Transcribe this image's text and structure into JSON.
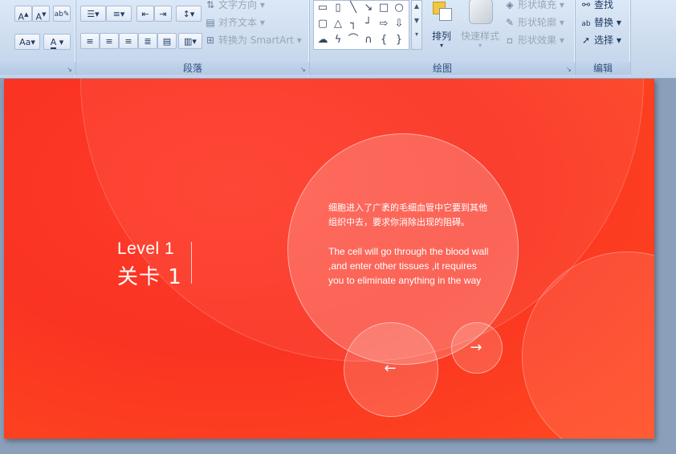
{
  "ribbon": {
    "paragraph_group": {
      "title": "段落",
      "text_direction_label": "文字方向",
      "align_text_label": "对齐文本",
      "smartart_label": "转换为 SmartArt"
    },
    "drawing_group": {
      "title": "绘图",
      "arrange_label": "排列",
      "quick_styles_label": "快速样式",
      "shape_fill_label": "形状填充",
      "shape_outline_label": "形状轮廓",
      "shape_effects_label": "形状效果"
    },
    "editing_group": {
      "title": "编辑",
      "find_label": "查找",
      "replace_label": "替换",
      "select_label": "选择"
    }
  },
  "slide": {
    "level_en": "Level 1",
    "level_cn": "关卡 1",
    "desc_cn": "细胞进入了广袤的毛细血管中它要到其他组织中去，要求你消除出现的阻碍。",
    "desc_en": "The cell will go through  the blood wall ,and  enter other tissues ,it requires you  to eliminate anything  in the way",
    "prev_arrow": "←",
    "next_arrow": "→"
  },
  "colors": {
    "slide_bg": "#fa3322",
    "ribbon_bg": "#cddcee",
    "canvas_bg": "#8a9fba"
  }
}
